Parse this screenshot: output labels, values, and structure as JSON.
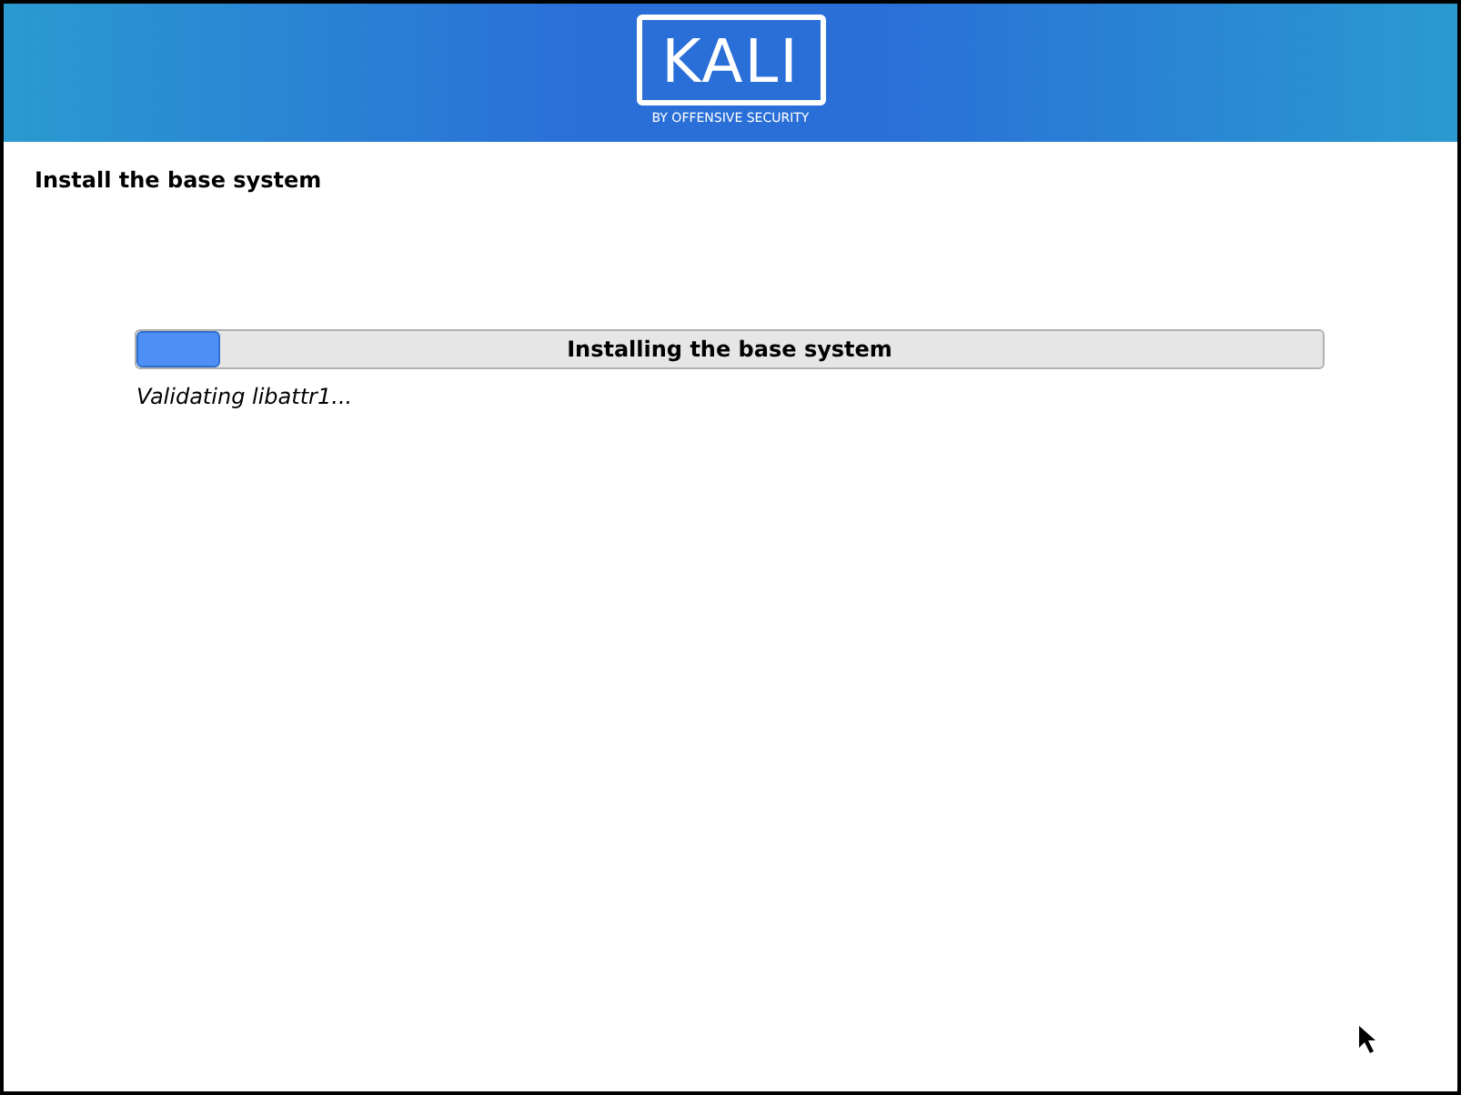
{
  "header": {
    "logo_text": "KALI",
    "logo_subtitle": "BY OFFENSIVE SECURITY"
  },
  "page_title": "Install the base system",
  "progress": {
    "label": "Installing the base system",
    "level": 0.07,
    "status": "Validating libattr1..."
  }
}
